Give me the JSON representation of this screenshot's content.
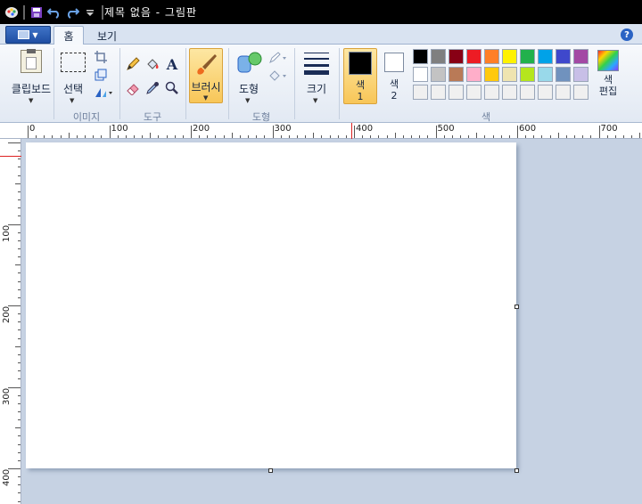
{
  "title": "제목 없음 - 그림판",
  "tabs": [
    {
      "label": "홈",
      "active": true
    },
    {
      "label": "보기",
      "active": false
    }
  ],
  "groups": {
    "clipboard": {
      "button": "클립보드"
    },
    "image": {
      "label": "이미지",
      "select": "선택"
    },
    "tools": {
      "label": "도구"
    },
    "brushes": {
      "button": "브러시"
    },
    "shapes": {
      "label": "도형",
      "button": "도형"
    },
    "size": {
      "button": "크기"
    },
    "colors": {
      "label": "색",
      "color1": "색\n1",
      "color1_value": "#000000",
      "color2": "색\n2",
      "color2_value": "#ffffff",
      "edit": "색\n편집"
    }
  },
  "palette": [
    [
      "#000000",
      "#7f7f7f",
      "#880015",
      "#ed1c24",
      "#ff7f27",
      "#fff200",
      "#22b14c",
      "#00a2e8",
      "#3f48cc",
      "#a349a4"
    ],
    [
      "#ffffff",
      "#c3c3c3",
      "#b97a57",
      "#ffaec9",
      "#ffc90e",
      "#efe4b0",
      "#b5e61d",
      "#99d9ea",
      "#7092be",
      "#c8bfe7"
    ],
    [
      "#f0f0f0",
      "#f0f0f0",
      "#f0f0f0",
      "#f0f0f0",
      "#f0f0f0",
      "#f0f0f0",
      "#f0f0f0",
      "#f0f0f0",
      "#f0f0f0",
      "#f0f0f0"
    ]
  ],
  "ruler_top": [
    "0",
    "100",
    "200",
    "300",
    "400",
    "500",
    "600",
    "700"
  ],
  "ruler_left": [
    "100",
    "200",
    "300",
    "400"
  ],
  "canvas_size": {
    "width": 600,
    "height": 400
  }
}
